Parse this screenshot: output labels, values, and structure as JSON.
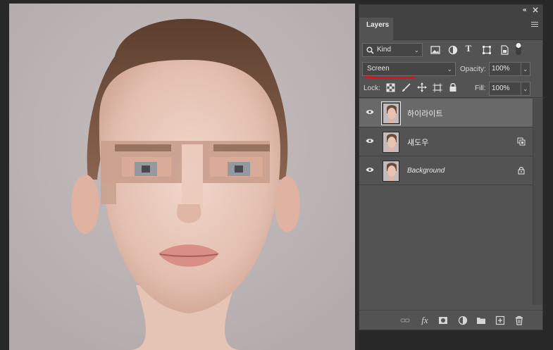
{
  "panel": {
    "collapse_icon": "«",
    "close_icon": "×",
    "tab_label": "Layers"
  },
  "filter": {
    "kind_label": "Kind",
    "icons": [
      "image-filter-icon",
      "adjustment-filter-icon",
      "type-filter-icon",
      "shape-filter-icon",
      "smart-object-filter-icon",
      "filter-toggle-icon"
    ]
  },
  "blend": {
    "mode": "Screen",
    "opacity_label": "Opacity:",
    "opacity_value": "100%",
    "annotation_color": "#e01010"
  },
  "lock": {
    "label": "Lock:",
    "fill_label": "Fill:",
    "fill_value": "100%"
  },
  "layers": [
    {
      "name": "하이라이트",
      "visible": true,
      "selected": true,
      "badge": ""
    },
    {
      "name": "섀도우",
      "visible": true,
      "selected": false,
      "badge": "smart-object-icon"
    },
    {
      "name": "Background",
      "visible": true,
      "selected": false,
      "badge": "lock-icon"
    }
  ],
  "bottom_icons": [
    "link-layers-icon",
    "fx-icon",
    "add-mask-icon",
    "adjustment-layer-icon",
    "new-group-icon",
    "new-layer-icon",
    "delete-layer-icon"
  ],
  "fx_label": "fx"
}
